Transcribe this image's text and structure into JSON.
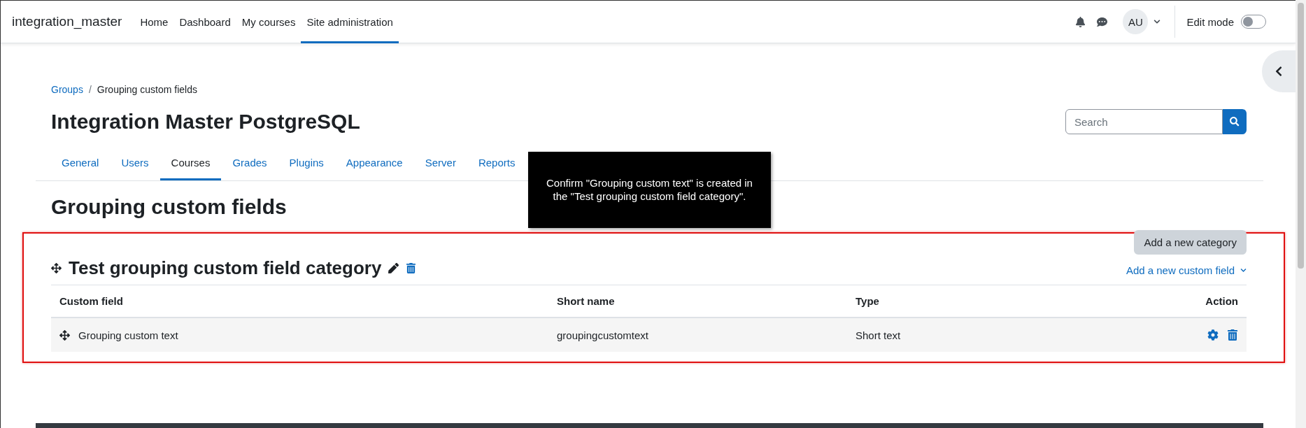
{
  "navbar": {
    "site_name": "integration_master",
    "links": [
      {
        "label": "Home",
        "selected": false
      },
      {
        "label": "Dashboard",
        "selected": false
      },
      {
        "label": "My courses",
        "selected": false
      },
      {
        "label": "Site administration",
        "selected": true
      }
    ],
    "user_initials": "AU",
    "edit_mode": {
      "label": "Edit mode",
      "on": false
    }
  },
  "breadcrumb_separator": "/",
  "breadcrumb": [
    {
      "label": "Groups",
      "kind": "link"
    },
    {
      "label": "Grouping custom fields",
      "kind": "current"
    }
  ],
  "site_title": "Integration Master PostgreSQL",
  "search": {
    "placeholder": "Search"
  },
  "admin_tabs": [
    {
      "label": "General",
      "selected": false
    },
    {
      "label": "Users",
      "selected": false
    },
    {
      "label": "Courses",
      "selected": true
    },
    {
      "label": "Grades",
      "selected": false
    },
    {
      "label": "Plugins",
      "selected": false
    },
    {
      "label": "Appearance",
      "selected": false
    },
    {
      "label": "Server",
      "selected": false
    },
    {
      "label": "Reports",
      "selected": false
    }
  ],
  "page_heading": "Grouping custom fields",
  "add_category_button": "Add a new category",
  "category": {
    "title": "Test grouping custom field category",
    "add_field_link": "Add a new custom field",
    "columns": [
      "Custom field",
      "Short name",
      "Type",
      "Action"
    ],
    "rows": [
      {
        "custom_field": "Grouping custom text",
        "short_name": "groupingcustomtext",
        "type": "Short text"
      }
    ]
  },
  "tooltip": "Confirm \"Grouping custom text\" is created in the \"Test grouping custom field category\"."
}
